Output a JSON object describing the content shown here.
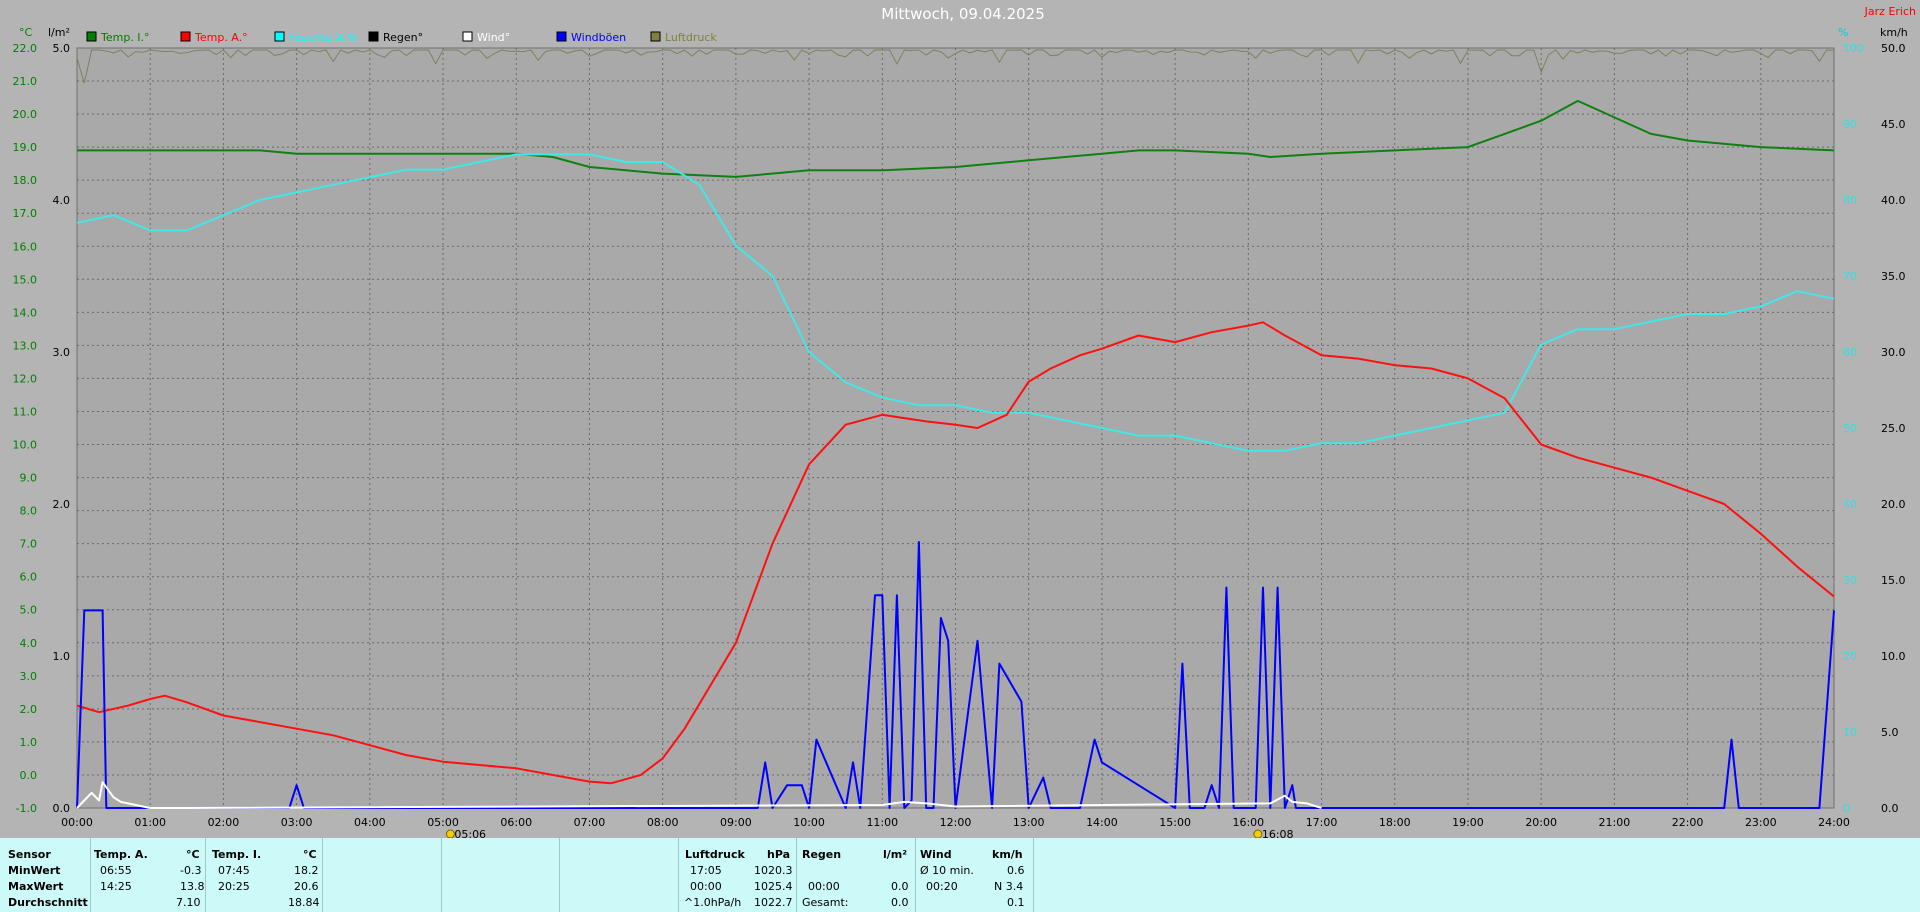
{
  "chart_data": {
    "type": "line",
    "title": "Mittwoch, 09.04.2025",
    "station": "Jarz Erich",
    "axis_labels": {
      "temp": "°C",
      "rain": "l/m²",
      "humidity": "%",
      "wind": "km/h"
    },
    "x_ticks": [
      "00:00",
      "01:00",
      "02:00",
      "03:00",
      "04:00",
      "05:00",
      "06:00",
      "07:00",
      "08:00",
      "09:00",
      "10:00",
      "11:00",
      "12:00",
      "13:00",
      "14:00",
      "15:00",
      "16:00",
      "17:00",
      "18:00",
      "19:00",
      "20:00",
      "21:00",
      "22:00",
      "23:00",
      "24:00"
    ],
    "temp_ticks": [
      "22.0",
      "21.0",
      "20.0",
      "19.0",
      "18.0",
      "17.0",
      "16.0",
      "15.0",
      "14.0",
      "13.0",
      "12.0",
      "11.0",
      "10.0",
      "9.0",
      "8.0",
      "7.0",
      "6.0",
      "5.0",
      "4.0",
      "3.0",
      "2.0",
      "1.0",
      "0.0",
      "-1.0"
    ],
    "temp_range": [
      -1,
      22
    ],
    "rain_ticks": [
      "5.0",
      "4.0",
      "3.0",
      "2.0",
      "1.0",
      "0.0"
    ],
    "rain_range": [
      0,
      5
    ],
    "humidity_ticks": [
      "100",
      "90",
      "80",
      "70",
      "60",
      "50",
      "40",
      "30",
      "20",
      "10",
      "0"
    ],
    "humidity_range": [
      0,
      100
    ],
    "wind_ticks": [
      "50.0",
      "45.0",
      "40.0",
      "35.0",
      "30.0",
      "25.0",
      "20.0",
      "15.0",
      "10.0",
      "5.0",
      "0.0"
    ],
    "wind_range": [
      0,
      50
    ],
    "markers": [
      {
        "time": 5.1,
        "label": "05:06"
      },
      {
        "time": 16.13,
        "label": "16:08"
      }
    ],
    "legend": [
      {
        "name": "Temp. I.°",
        "color": "#008000"
      },
      {
        "name": "Temp. A.°",
        "color": "#ff0000"
      },
      {
        "name": "Feuchte A.%",
        "color": "#00ffff"
      },
      {
        "name": "Regen°",
        "color": "#000000"
      },
      {
        "name": "Wind°",
        "color": "#ffffff"
      },
      {
        "name": "Windböen",
        "color": "#0000ff"
      },
      {
        "name": "Luftdruck",
        "color": "#808040"
      }
    ],
    "series": [
      {
        "name": "Temp. I.°",
        "axis": "temp",
        "color": "#108010",
        "x": [
          0,
          2.5,
          3,
          4.5,
          5,
          6,
          6.5,
          7,
          7.5,
          8,
          9,
          10,
          11,
          12,
          13,
          14,
          14.5,
          15,
          16,
          16.3,
          17,
          18,
          19,
          19.5,
          20,
          20.5,
          21,
          21.5,
          22,
          23,
          24
        ],
        "y": [
          18.9,
          18.9,
          18.8,
          18.8,
          18.8,
          18.8,
          18.7,
          18.4,
          18.3,
          18.2,
          18.1,
          18.3,
          18.3,
          18.4,
          18.6,
          18.8,
          18.9,
          18.9,
          18.8,
          18.7,
          18.8,
          18.9,
          19.0,
          19.4,
          19.8,
          20.4,
          19.9,
          19.4,
          19.2,
          19.0,
          18.9
        ]
      },
      {
        "name": "Feuchte A.%",
        "axis": "humidity",
        "color": "#40e8e8",
        "x": [
          0,
          0.5,
          1,
          1.5,
          2,
          2.5,
          3,
          3.5,
          4,
          4.5,
          5,
          5.5,
          6,
          6.5,
          7,
          7.5,
          8,
          8.5,
          9,
          9.5,
          10,
          10.5,
          11,
          11.5,
          12,
          12.5,
          13,
          13.5,
          14,
          14.5,
          15,
          15.5,
          16,
          16.5,
          17,
          17.5,
          18,
          18.5,
          19,
          19.5,
          20,
          20.5,
          21,
          21.5,
          22,
          22.5,
          23,
          23.5,
          24
        ],
        "y": [
          77,
          78,
          76,
          76,
          78,
          80,
          81,
          82,
          83,
          84,
          84,
          85,
          86,
          86,
          86,
          85,
          85,
          82,
          74,
          70,
          60,
          56,
          54,
          53,
          53,
          52,
          52,
          51,
          50,
          49,
          49,
          48,
          47,
          47,
          48,
          48,
          49,
          50,
          51,
          52,
          61,
          63,
          63,
          64,
          65,
          65,
          66,
          68,
          67
        ]
      },
      {
        "name": "Temp. A.°",
        "axis": "temp",
        "color": "#ff1010",
        "x": [
          0,
          0.3,
          0.7,
          1,
          1.2,
          1.5,
          2,
          2.5,
          3,
          3.5,
          4,
          4.5,
          5,
          5.5,
          6,
          6.5,
          7,
          7.3,
          7.7,
          8,
          8.3,
          9,
          9.5,
          10,
          10.5,
          11,
          11.3,
          11.6,
          12,
          12.3,
          12.7,
          13,
          13.3,
          13.7,
          14,
          14.5,
          15,
          15.5,
          16,
          16.2,
          16.5,
          17,
          17.5,
          18,
          18.5,
          19,
          19.5,
          20,
          20.5,
          21,
          21.5,
          22,
          22.5,
          23,
          23.5,
          24
        ],
        "y": [
          2.1,
          1.9,
          2.1,
          2.3,
          2.4,
          2.2,
          1.8,
          1.6,
          1.4,
          1.2,
          0.9,
          0.6,
          0.4,
          0.3,
          0.2,
          0.0,
          -0.2,
          -0.25,
          0.0,
          0.5,
          1.4,
          4.0,
          7.0,
          9.4,
          10.6,
          10.9,
          10.8,
          10.7,
          10.6,
          10.5,
          10.9,
          11.9,
          12.3,
          12.7,
          12.9,
          13.3,
          13.1,
          13.4,
          13.6,
          13.7,
          13.3,
          12.7,
          12.6,
          12.4,
          12.3,
          12.0,
          11.4,
          10.0,
          9.6,
          9.3,
          9.0,
          8.6,
          8.2,
          7.3,
          6.3,
          5.4
        ]
      },
      {
        "name": "Windböen",
        "axis": "wind",
        "color": "#0000ff",
        "x": [
          0,
          0.1,
          0.18,
          0.35,
          0.4,
          2.9,
          3.0,
          3.1,
          9.3,
          9.4,
          9.5,
          9.7,
          9.9,
          10.0,
          10.1,
          10.5,
          10.6,
          10.7,
          10.9,
          11.0,
          11.1,
          11.2,
          11.3,
          11.4,
          11.5,
          11.6,
          11.7,
          11.8,
          11.9,
          12.0,
          12.3,
          12.5,
          12.6,
          12.9,
          13.0,
          13.2,
          13.3,
          13.5,
          13.7,
          13.9,
          14.0,
          15.0,
          15.1,
          15.2,
          15.4,
          15.5,
          15.6,
          15.7,
          15.8,
          15.9,
          16.1,
          16.2,
          16.3,
          16.4,
          16.5,
          16.6,
          16.65,
          16.7,
          16.8,
          17.0,
          22.5,
          22.6,
          22.7,
          23.8,
          24.0
        ],
        "y": [
          0,
          13,
          13,
          13,
          0,
          0,
          1.5,
          0,
          0,
          3,
          0,
          1.5,
          1.5,
          0,
          4.5,
          0,
          3,
          0,
          14,
          14,
          0,
          14,
          0,
          0.5,
          17.5,
          0,
          0,
          12.5,
          11,
          0,
          11,
          0,
          9.5,
          7,
          0,
          2,
          0,
          0,
          0,
          4.5,
          3,
          0,
          9.5,
          0,
          0,
          1.5,
          0,
          14.5,
          0,
          0,
          0,
          14.5,
          0,
          14.5,
          0,
          1.5,
          0,
          0,
          0,
          0,
          0,
          4.5,
          0,
          0,
          13
        ]
      },
      {
        "name": "Wind°",
        "axis": "wind",
        "color": "#ffffff",
        "x": [
          0,
          0.2,
          0.3,
          0.35,
          0.5,
          0.6,
          1.0,
          1.5,
          11,
          11.3,
          11.6,
          12.0,
          16.3,
          16.5,
          16.6,
          16.8,
          17.0
        ],
        "y": [
          0,
          1,
          0.5,
          1.7,
          0.7,
          0.4,
          0,
          0,
          0.2,
          0.4,
          0.3,
          0.1,
          0.3,
          0.8,
          0.4,
          0.3,
          0
        ]
      }
    ],
    "pressure_note": "Luftdruck trace near top of chart"
  },
  "table": {
    "col1": {
      "h_sensor": "Sensor",
      "h_min": "MinWert",
      "h_max": "MaxWert",
      "h_avg": "Durchschnitt"
    },
    "temp_a": {
      "title": "Temp. A.",
      "unit": "°C",
      "min_time": "06:55",
      "min_val": "-0.3",
      "max_time": "14:25",
      "max_val": "13.8",
      "avg": "7.10"
    },
    "temp_i": {
      "title": "Temp. I.",
      "unit": "°C",
      "min_time": "07:45",
      "min_val": "18.2",
      "max_time": "20:25",
      "max_val": "20.6",
      "avg": "18.84"
    },
    "pressure": {
      "title": "Luftdruck",
      "unit": "hPa",
      "min_time": "17:05",
      "min_val": "1020.3",
      "max_time": "00:00",
      "max_val": "1025.4",
      "trend": "^1.0hPa/h",
      "avg": "1022.7"
    },
    "rain": {
      "title": "Regen",
      "unit": "l/m²",
      "max_time": "00:00",
      "max_val": "0.0",
      "total_label": "Gesamt:",
      "total": "0.0"
    },
    "wind": {
      "title": "Wind",
      "unit": "km/h",
      "avg_label": "Ø 10 min.",
      "avg_val": "0.6",
      "max_time": "00:20",
      "max_val": "N 3.4",
      "mean": "0.1"
    }
  }
}
